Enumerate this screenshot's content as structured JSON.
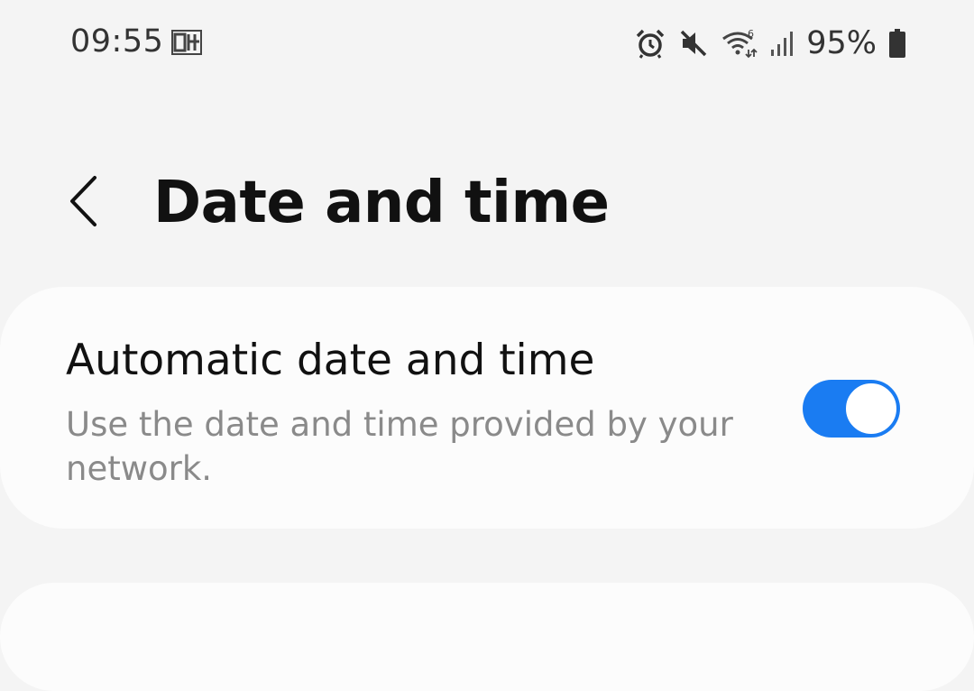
{
  "status_bar": {
    "time": "09:55",
    "battery": "95%",
    "icons": [
      "sim-icon",
      "alarm-icon",
      "mute-icon",
      "wifi-icon",
      "signal-icon",
      "battery-icon"
    ]
  },
  "header": {
    "title": "Date and time",
    "back_icon": "chevron-left-icon"
  },
  "automatic_date_time": {
    "title": "Automatic date and time",
    "description": "Use the date and time provided by your network.",
    "enabled": true
  },
  "colors": {
    "accent": "#1a7cf2",
    "background": "#f4f4f4",
    "card": "#fcfcfc",
    "secondary_text": "#8a8a8a"
  }
}
